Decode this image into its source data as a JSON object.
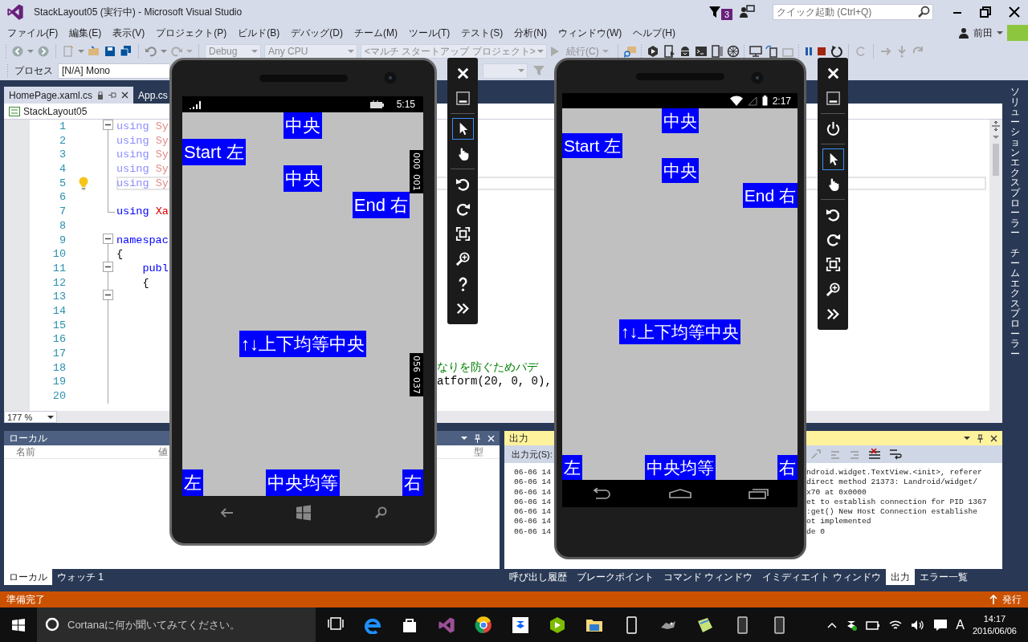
{
  "window": {
    "title": "StackLayout05 (実行中) - Microsoft Visual Studio",
    "notification_count": "3",
    "quick_launch": {
      "placeholder": "クイック起動 (Ctrl+Q)"
    }
  },
  "menu": [
    "ファイル(F)",
    "編集(E)",
    "表示(V)",
    "プロジェクト(P)",
    "ビルド(B)",
    "デバッグ(D)",
    "チーム(M)",
    "ツール(T)",
    "テスト(S)",
    "分析(N)",
    "ウィンドウ(W)",
    "ヘルプ(H)"
  ],
  "user": {
    "name": "前田"
  },
  "toolbar": {
    "configuration": "Debug",
    "platform": "Any CPU",
    "startup_project": "<マルチ スタートアップ プロジェクト>",
    "continue": "続行(C)"
  },
  "process_bar": {
    "label": "プロセス",
    "value": "[N/A] Mono"
  },
  "document_tabs": [
    {
      "label": "HomePage.xaml.cs",
      "selected": true
    },
    {
      "label": "App.cs",
      "selected": false
    }
  ],
  "editor": {
    "scope": "StackLayout05",
    "zoom": "177 %",
    "lines": [
      {
        "number": "1",
        "kind": "fold-start",
        "current": false,
        "code": [
          {
            "text": "using",
            "kind": "unused-keyword"
          },
          {
            "text": "Sy",
            "kind": "unused-name"
          }
        ]
      },
      {
        "number": "2",
        "kind": "fold-line",
        "current": false,
        "code": [
          {
            "text": "using",
            "kind": "unused-keyword"
          },
          {
            "text": "Sy",
            "kind": "unused-name"
          }
        ]
      },
      {
        "number": "3",
        "kind": "fold-line",
        "current": false,
        "code": [
          {
            "text": "using",
            "kind": "unused-keyword"
          },
          {
            "text": "Sy",
            "kind": "unused-name"
          }
        ]
      },
      {
        "number": "4",
        "kind": "fold-line",
        "current": false,
        "code": [
          {
            "text": "using",
            "kind": "unused-keyword"
          },
          {
            "text": "Sy",
            "kind": "unused-name"
          }
        ]
      },
      {
        "number": "5",
        "kind": "fold-line",
        "current": true,
        "code": [
          {
            "text": "using",
            "kind": "unused-keyword"
          },
          {
            "text": "Sy",
            "kind": "unused-name"
          }
        ]
      },
      {
        "number": "6",
        "kind": "fold-line",
        "current": false
      },
      {
        "number": "7",
        "kind": "fold-end",
        "current": false,
        "code": [
          {
            "text": "using",
            "kind": "keyword"
          },
          {
            "text": "Xa",
            "kind": "name"
          }
        ]
      },
      {
        "number": "8",
        "kind": "plain",
        "current": false
      },
      {
        "number": "9",
        "kind": "fold-start",
        "current": false,
        "code": [
          {
            "text": "namespac",
            "kind": "keyword"
          }
        ]
      },
      {
        "number": "10",
        "kind": "fold-line",
        "current": false,
        "code": [
          {
            "text": "{",
            "kind": "plain"
          }
        ]
      },
      {
        "number": "11",
        "kind": "fold-start",
        "current": false,
        "code": [
          {
            "text": "    publ",
            "kind": "keyword"
          }
        ]
      },
      {
        "number": "12",
        "kind": "fold-line",
        "current": false,
        "code": [
          {
            "text": "    {",
            "kind": "plain"
          }
        ]
      },
      {
        "number": "13",
        "kind": "fold-start",
        "current": false
      },
      {
        "number": "14",
        "kind": "fold-line",
        "current": false
      },
      {
        "number": "15",
        "kind": "fold-line",
        "current": false
      },
      {
        "number": "16",
        "kind": "fold-line",
        "current": false
      },
      {
        "number": "17",
        "kind": "fold-line",
        "current": false
      },
      {
        "number": "18",
        "kind": "fold-line",
        "current": false,
        "mid": {
          "text": "なりを防ぐためパデ",
          "kind": "comment"
        }
      },
      {
        "number": "19",
        "kind": "fold-line",
        "current": false,
        "mid": {
          "text": "atform(20, 0, 0),",
          "kind": "plain"
        }
      },
      {
        "number": "20",
        "kind": "fold-line",
        "current": false
      }
    ]
  },
  "locals_panel": {
    "title": "ローカル",
    "columns": [
      "名前",
      "値",
      "型"
    ],
    "tabs": [
      {
        "label": "ローカル",
        "selected": true
      },
      {
        "label": "ウォッチ 1",
        "selected": false
      }
    ]
  },
  "output_panel": {
    "title": "出力",
    "source_label": "出力元(S):",
    "lines": [
      {
        "left": "06-06 14",
        "right": "ndroid.widget.TextView.<init>, referer"
      },
      {
        "left": "06-06 14",
        "right": "direct method 21373: Landroid/widget/"
      },
      {
        "left": "06-06 14",
        "right": "x70 at 0x0000"
      },
      {
        "left": "06-06 14",
        "right": "et to establish connection for PID 1367"
      },
      {
        "left": "06-06 14",
        "right": ":get() New Host Connection establishe"
      },
      {
        "left": "06-06 14",
        "right": "ot implemented"
      },
      {
        "left": "06-06 14",
        "right": "de 0"
      }
    ],
    "tabs": [
      {
        "label": "呼び出し履歴",
        "selected": false
      },
      {
        "label": "ブレークポイント",
        "selected": false
      },
      {
        "label": "コマンド ウィンドウ",
        "selected": false
      },
      {
        "label": "イミディエイト ウィンドウ",
        "selected": false
      },
      {
        "label": "出力",
        "selected": true
      },
      {
        "label": "エラー一覧",
        "selected": false
      }
    ]
  },
  "side_tabs": [
    "ソリューションエクスプローラー",
    "チームエクスプローラー"
  ],
  "status_bar": {
    "text": "準備完了",
    "action": "発行"
  },
  "taskbar": {
    "search_placeholder": "Cortanaに何か聞いてみてください。",
    "input_indicator": "A",
    "time": "14:17",
    "date": "2016/06/06"
  },
  "emulators": [
    {
      "kind": "windows-phone",
      "time": "5:15",
      "stack": [
        {
          "text": "中央",
          "kind": "center"
        },
        {
          "text": "Start 左",
          "kind": "start"
        },
        {
          "text": "中央",
          "kind": "center"
        },
        {
          "text": "End 右",
          "kind": "end"
        }
      ],
      "middle": "↑↓上下均等中央",
      "bottom": [
        "左",
        "中央均等",
        "右"
      ],
      "counters": [
        [
          "000",
          "001"
        ],
        [
          "056",
          "037"
        ]
      ],
      "tools": [
        {
          "kind": "close",
          "selected": false
        },
        {
          "kind": "minimize",
          "selected": false
        },
        {
          "kind": "pointer",
          "selected": true
        },
        {
          "kind": "hand",
          "selected": false
        },
        {
          "kind": "rotate-left",
          "selected": false
        },
        {
          "kind": "rotate-right",
          "selected": false
        },
        {
          "kind": "fit",
          "selected": false
        },
        {
          "kind": "zoom",
          "selected": false
        },
        {
          "kind": "help",
          "selected": false
        },
        {
          "kind": "more",
          "selected": false
        }
      ]
    },
    {
      "kind": "android",
      "time": "2:17",
      "stack": [
        {
          "text": "中央",
          "kind": "center"
        },
        {
          "text": "Start 左",
          "kind": "start"
        },
        {
          "text": "中央",
          "kind": "center"
        },
        {
          "text": "End 右",
          "kind": "end"
        }
      ],
      "middle": "↑↓上下均等中央",
      "bottom": [
        "左",
        "中央均等",
        "右"
      ],
      "tools": [
        {
          "kind": "close",
          "selected": false
        },
        {
          "kind": "minimize",
          "selected": false
        },
        {
          "kind": "power",
          "selected": false
        },
        {
          "kind": "pointer",
          "selected": true
        },
        {
          "kind": "hand",
          "selected": false
        },
        {
          "kind": "rotate-left",
          "selected": false
        },
        {
          "kind": "rotate-right",
          "selected": false
        },
        {
          "kind": "fit",
          "selected": false
        },
        {
          "kind": "zoom",
          "selected": false
        },
        {
          "kind": "more",
          "selected": false
        }
      ]
    }
  ]
}
